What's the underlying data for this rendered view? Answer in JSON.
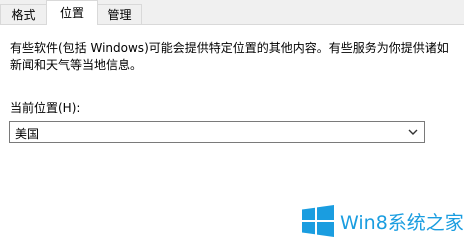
{
  "tabs": [
    {
      "label": "格式"
    },
    {
      "label": "位置"
    },
    {
      "label": "管理"
    }
  ],
  "active_tab": "位置",
  "description": "有些软件(包括 Windows)可能会提供特定位置的其他内容。有些服务为你提供诸如新闻和天气等当地信息。",
  "location_label": "当前位置(H):",
  "location_select": {
    "value": "美国"
  },
  "watermark": {
    "text": "Win8系统之家",
    "color": "#1a9de0"
  }
}
